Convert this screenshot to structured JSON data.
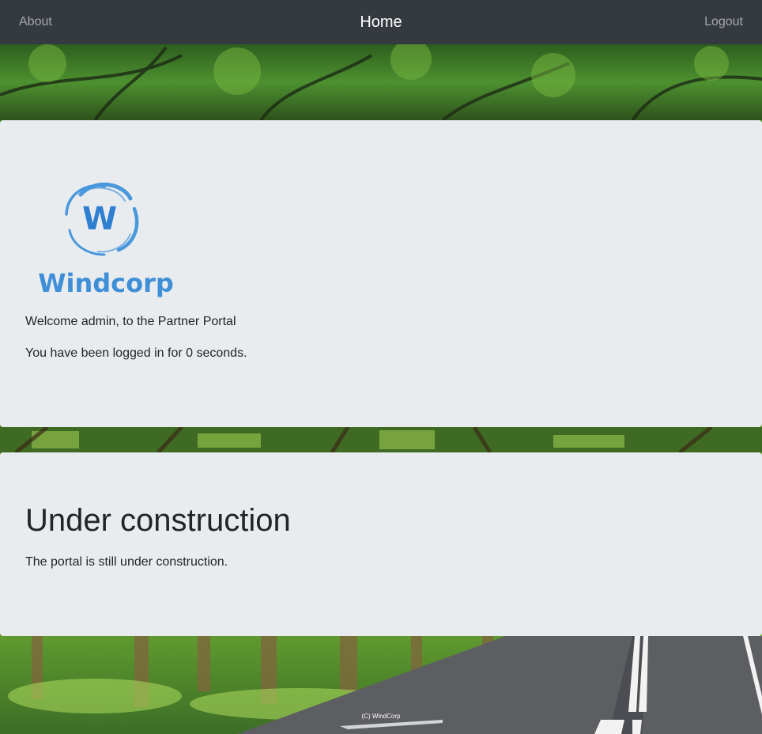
{
  "nav": {
    "about_label": "About",
    "home_label": "Home",
    "logout_label": "Logout"
  },
  "logo": {
    "text": "Windcorp",
    "color": "#3f8fd8"
  },
  "welcome": {
    "message": "Welcome admin, to the Partner Portal",
    "logged_in_text": "You have been logged in for 0 seconds."
  },
  "construction": {
    "heading": "Under construction",
    "text": "The portal is still under construction."
  },
  "footer": {
    "copyright": "(C) WindCorp"
  },
  "colors": {
    "navbar": "#343a40",
    "panel": "#e9ecef",
    "text": "#212529"
  }
}
